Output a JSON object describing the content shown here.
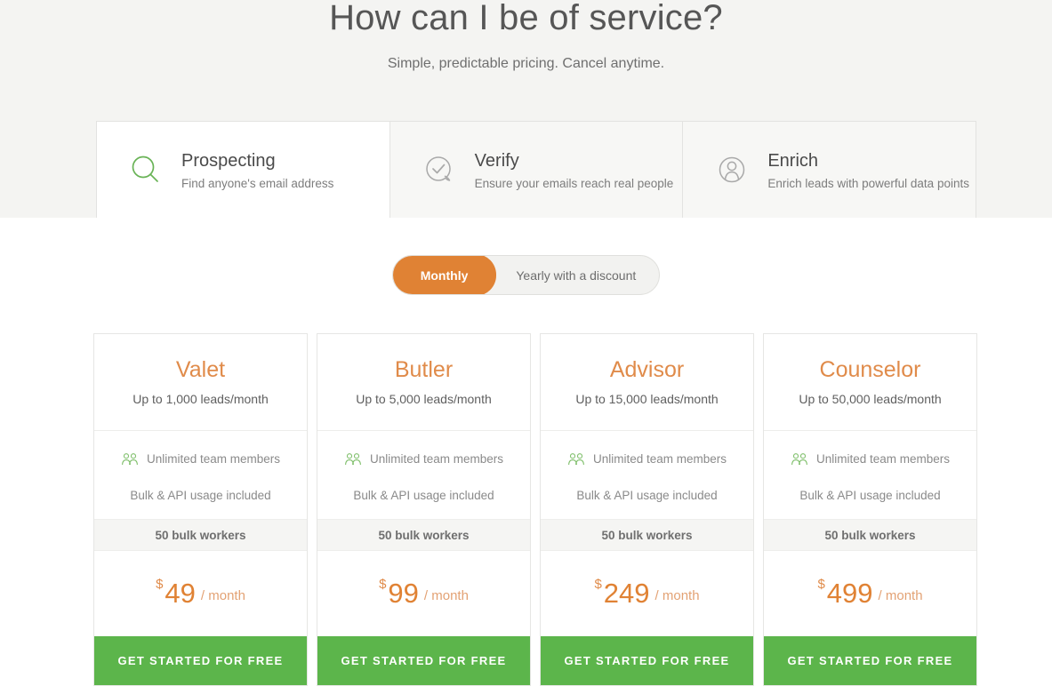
{
  "header": {
    "title": "How can I be of service?",
    "subtitle": "Simple, predictable pricing. Cancel anytime."
  },
  "tabs": [
    {
      "label": "Prospecting",
      "description": "Find anyone's email address",
      "icon": "search-icon",
      "active": true
    },
    {
      "label": "Verify",
      "description": "Ensure your emails reach real people",
      "icon": "check-bubble-icon",
      "active": false
    },
    {
      "label": "Enrich",
      "description": "Enrich leads with powerful data points",
      "icon": "person-circle-icon",
      "active": false
    }
  ],
  "billing_toggle": {
    "monthly_label": "Monthly",
    "yearly_label": "Yearly with a discount",
    "selected": "Monthly"
  },
  "plans": [
    {
      "name": "Valet",
      "leads": "Up to 1,000 leads/month",
      "team_feature": "Unlimited team members",
      "team_icon": "people-icon",
      "bulk_feature": "Bulk & API usage included",
      "workers": "50 bulk workers",
      "currency": "$",
      "price": "49",
      "period": "/ month",
      "cta": "GET STARTED FOR FREE"
    },
    {
      "name": "Butler",
      "leads": "Up to 5,000 leads/month",
      "team_feature": "Unlimited team members",
      "team_icon": "people-icon",
      "bulk_feature": "Bulk & API usage included",
      "workers": "50 bulk workers",
      "currency": "$",
      "price": "99",
      "period": "/ month",
      "cta": "GET STARTED FOR FREE"
    },
    {
      "name": "Advisor",
      "leads": "Up to 15,000 leads/month",
      "team_feature": "Unlimited team members",
      "team_icon": "people-icon",
      "bulk_feature": "Bulk & API usage included",
      "workers": "50 bulk workers",
      "currency": "$",
      "price": "249",
      "period": "/ month",
      "cta": "GET STARTED FOR FREE"
    },
    {
      "name": "Counselor",
      "leads": "Up to 50,000 leads/month",
      "team_feature": "Unlimited team members",
      "team_icon": "people-icon",
      "bulk_feature": "Bulk & API usage included",
      "workers": "50 bulk workers",
      "currency": "$",
      "price": "499",
      "period": "/ month",
      "cta": "GET STARTED FOR FREE"
    }
  ],
  "colors": {
    "accent_orange": "#e08234",
    "plan_name_orange": "#e08b4a",
    "cta_green": "#5cb54b",
    "icon_green": "#69b356",
    "band_gray": "#f4f4f2",
    "text_dark": "#565656"
  }
}
